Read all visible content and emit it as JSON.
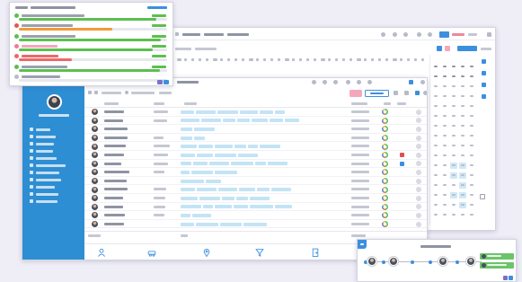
{
  "theme": {
    "background": "#efeef7",
    "sidebar": "#2e8ed3",
    "accent": "#3b8fe0",
    "tag_chip": "#c3e4f5",
    "green": "#5cbf4f",
    "orange": "#f29a38",
    "red": "#ec6868",
    "pink": "#f4a7bb",
    "calendar_highlight": "#cfe8f7"
  },
  "progress_panel": {
    "rows": [
      {
        "level": 0.93,
        "bar_color": "#5cbf4f",
        "icon": "check-circle-icon",
        "icon_color": "#5cbf4f"
      },
      {
        "level": 0.63,
        "bar_color": "#f29a38",
        "icon": "flag-icon",
        "icon_color": "#e2584f"
      },
      {
        "level": 0.96,
        "bar_color": "#5cbf4f",
        "icon": "status-dot-icon",
        "icon_color": "#5cbf4f"
      },
      {
        "level": 0.9,
        "bar_color": "#5cbf4f",
        "icon": "warning-icon",
        "icon_color": "#f07a98"
      },
      {
        "level": 0.36,
        "bar_color": "#ec6868",
        "icon": "status-dot-icon",
        "icon_color": "#ec6868"
      },
      {
        "level": 0.95,
        "bar_color": "#5cbf4f",
        "icon": "status-dot-icon",
        "icon_color": "#5cbf4f"
      },
      {
        "level": 0.0,
        "bar_color": "#5cbf4f",
        "icon": "status-dot-icon",
        "icon_color": "#b9bcc8"
      }
    ]
  },
  "sidebar": {
    "items": [
      {
        "icon": "menu-icon"
      },
      {
        "icon": "menu-icon"
      },
      {
        "icon": "menu-icon"
      },
      {
        "icon": "menu-icon"
      },
      {
        "icon": "menu-icon"
      },
      {
        "icon": "menu-icon"
      },
      {
        "icon": "menu-icon"
      },
      {
        "icon": "menu-icon"
      },
      {
        "icon": "menu-icon"
      },
      {
        "icon": "menu-icon"
      },
      {
        "icon": "menu-icon"
      }
    ]
  },
  "task_table": {
    "rows": [
      {
        "tags": 6,
        "role": true,
        "progress_ring": true,
        "flag": null
      },
      {
        "tags": 7,
        "role": true,
        "progress_ring": true,
        "flag": null
      },
      {
        "tags": 2,
        "role": false,
        "progress_ring": true,
        "flag": null
      },
      {
        "tags": 2,
        "role": true,
        "progress_ring": true,
        "flag": null
      },
      {
        "tags": 6,
        "role": true,
        "progress_ring": true,
        "flag": null
      },
      {
        "tags": 4,
        "role": true,
        "progress_ring": true,
        "flag": "#e0504a"
      },
      {
        "tags": 6,
        "role": true,
        "progress_ring": true,
        "flag": "#3b8fe0"
      },
      {
        "tags": 3,
        "role": true,
        "progress_ring": true,
        "flag": null
      },
      {
        "tags": 2,
        "role": false,
        "progress_ring": true,
        "flag": null
      },
      {
        "tags": 6,
        "role": true,
        "progress_ring": true,
        "flag": null
      },
      {
        "tags": 5,
        "role": true,
        "progress_ring": true,
        "flag": null
      },
      {
        "tags": 6,
        "role": true,
        "progress_ring": true,
        "flag": null
      },
      {
        "tags": 2,
        "role": true,
        "progress_ring": true,
        "flag": null
      },
      {
        "tags": 4,
        "role": false,
        "progress_ring": true,
        "flag": null
      }
    ]
  },
  "bottom_nav": {
    "icons": [
      "person-icon",
      "car-icon",
      "pin-icon",
      "funnel-icon",
      "door-icon"
    ]
  },
  "timeline_popup": {
    "events": [
      {
        "icon": "avatar-icon"
      },
      {
        "icon": "avatar-icon"
      },
      {
        "icon": "avatar-icon"
      },
      {
        "icon": "avatar-icon"
      }
    ],
    "badges": [
      {
        "color": "#6cc36a"
      },
      {
        "color": "#6cc36a"
      }
    ]
  }
}
